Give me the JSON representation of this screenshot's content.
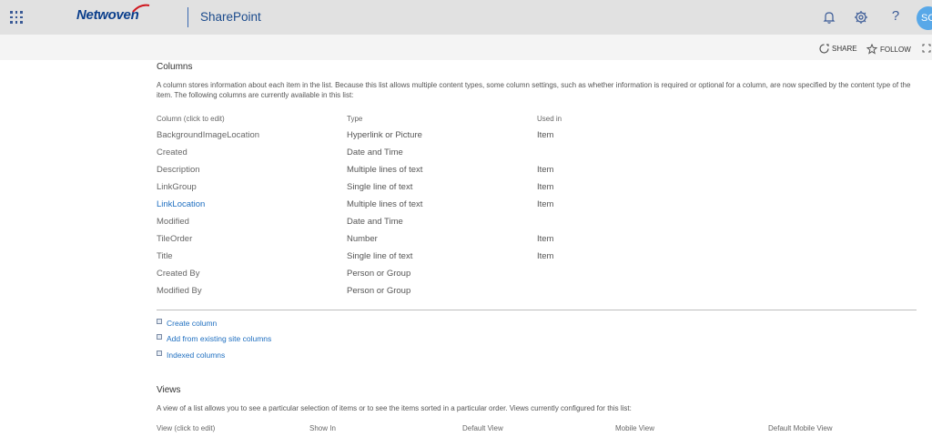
{
  "header": {
    "logo_text": "Netwoven",
    "app_name": "SharePoint",
    "avatar_initials": "SC",
    "help_glyph": "?",
    "icons": [
      "waffle-icon",
      "bell-icon",
      "gear-icon",
      "help-icon"
    ]
  },
  "commandbar": {
    "share_label": "SHARE",
    "follow_label": "FOLLOW"
  },
  "columns_section": {
    "title": "Columns",
    "description": "A column stores information about each item in the list. Because this list allows multiple content types, some column settings, such as whether information is required or optional for a column, are now specified by the content type of the item. The following columns are currently available in this list:",
    "headers": [
      "Column (click to edit)",
      "Type",
      "Used in"
    ],
    "rows": [
      {
        "name": "BackgroundImageLocation",
        "type": "Hyperlink or Picture",
        "used_in": "Item"
      },
      {
        "name": "Created",
        "type": "Date and Time",
        "used_in": ""
      },
      {
        "name": "Description",
        "type": "Multiple lines of text",
        "used_in": "Item"
      },
      {
        "name": "LinkGroup",
        "type": "Single line of text",
        "used_in": "Item"
      },
      {
        "name": "LinkLocation",
        "type": "Multiple lines of text",
        "used_in": "Item"
      },
      {
        "name": "Modified",
        "type": "Date and Time",
        "used_in": ""
      },
      {
        "name": "TileOrder",
        "type": "Number",
        "used_in": "Item"
      },
      {
        "name": "Title",
        "type": "Single line of text",
        "used_in": "Item"
      },
      {
        "name": "Created By",
        "type": "Person or Group",
        "used_in": ""
      },
      {
        "name": "Modified By",
        "type": "Person or Group",
        "used_in": ""
      }
    ],
    "actions": [
      "Create column",
      "Add from existing site columns",
      "Indexed columns"
    ]
  },
  "views_section": {
    "title": "Views",
    "description": "A view of a list allows you to see a particular selection of items or to see the items sorted in a particular order. Views currently configured for this list:",
    "headers": [
      "View (click to edit)",
      "Show In",
      "Default View",
      "Mobile View",
      "Default Mobile View"
    ]
  },
  "colors": {
    "suitebar": "#e1e1e1",
    "brand": "#0b3f8c",
    "link": "#1f6fc0",
    "avatar": "#58a8e8"
  }
}
